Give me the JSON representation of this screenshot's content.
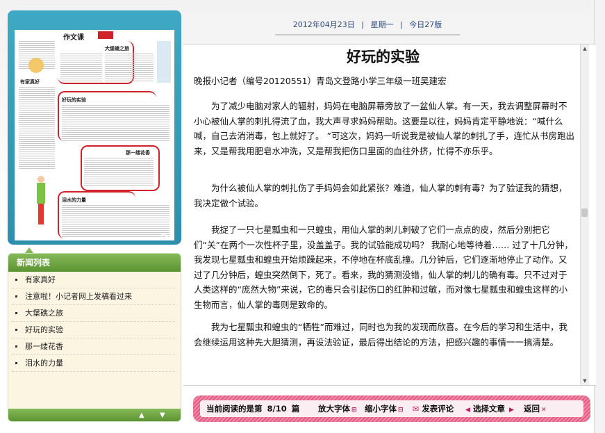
{
  "header": {
    "date": "2012年04月23日",
    "weekday": "星期一",
    "edition": "今日27版"
  },
  "thumbnail": {
    "section_label": "作文课",
    "headlines": [
      "大堡礁之旅",
      "有家真好",
      "好玩的实验",
      "那一缕花香",
      "泪水的力量"
    ]
  },
  "news_list": {
    "title": "新闻列表",
    "items": [
      {
        "label": "有家真好"
      },
      {
        "label": "注意啦！小记者网上发稿看过来"
      },
      {
        "label": "大堡礁之旅"
      },
      {
        "label": "好玩的实验"
      },
      {
        "label": "那一缕花香"
      },
      {
        "label": "泪水的力量"
      }
    ]
  },
  "article": {
    "title": "好玩的实验",
    "author": "晚报小记者（编号20120551）青岛文登路小学三年级一班吴建宏",
    "paragraphs": [
      "为了减少电脑对家人的辐射，妈妈在电脑屏幕旁放了一盆仙人掌。有一天，我去调整屏幕时不小心被仙人掌的刺扎得流了血，我大声寻求妈妈帮助。这要是以往，妈妈肯定平静地说：“喊什么喊，自己去消消毒，包上就好了。 ”可这次，妈妈一听说我是被仙人掌的刺扎了手，连忙从书房跑出来，又是帮我用肥皂水冲洗，又是帮我把伤口里面的血往外挤，忙得不亦乐乎。",
      "为什么被仙人掌的刺扎伤了手妈妈会如此紧张？难道，仙人掌的刺有毒？为了验证我的猜想，我决定做个试验。",
      "我捉了一只七星瓢虫和一只蝗虫，用仙人掌的刺儿刺破了它们一点点的皮，然后分别把它们“关”在两个一次性杯子里，没盖盖子。我的试验能成功吗？ 我耐心地等待着…… 过了十几分钟，我发现七星瓢虫和蝗虫开始烦躁起来，不停地在杯底乱撞。几分钟后，它们逐渐地停止了动作。又过了几分钟后，蝗虫突然倒下，死了。看来，我的猜测没错，仙人掌的刺儿的确有毒。只不过对于人类这样的“庞然大物”来说，它的毒只会引起伤口的红肿和过敏，而对像七星瓢虫和蝗虫这样的小生物而言，仙人掌的毒则是致命的。",
      "我为七星瓢虫和蝗虫的“牺牲”而难过，同时也为我的发现而欣喜。在今后的学习和生活中，我会继续运用这种先大胆猜测，再设法验证，最后得出结论的方法，把感兴趣的事情一一搞清楚。"
    ]
  },
  "toolbar": {
    "reading_prefix": "当前阅读的是第",
    "reading_count": "8/10",
    "reading_suffix": "篇",
    "enlarge_font": "放大字体",
    "shrink_font": "缩小字体",
    "comment": "发表评论",
    "select_article": "选择文章",
    "back": "返回"
  }
}
